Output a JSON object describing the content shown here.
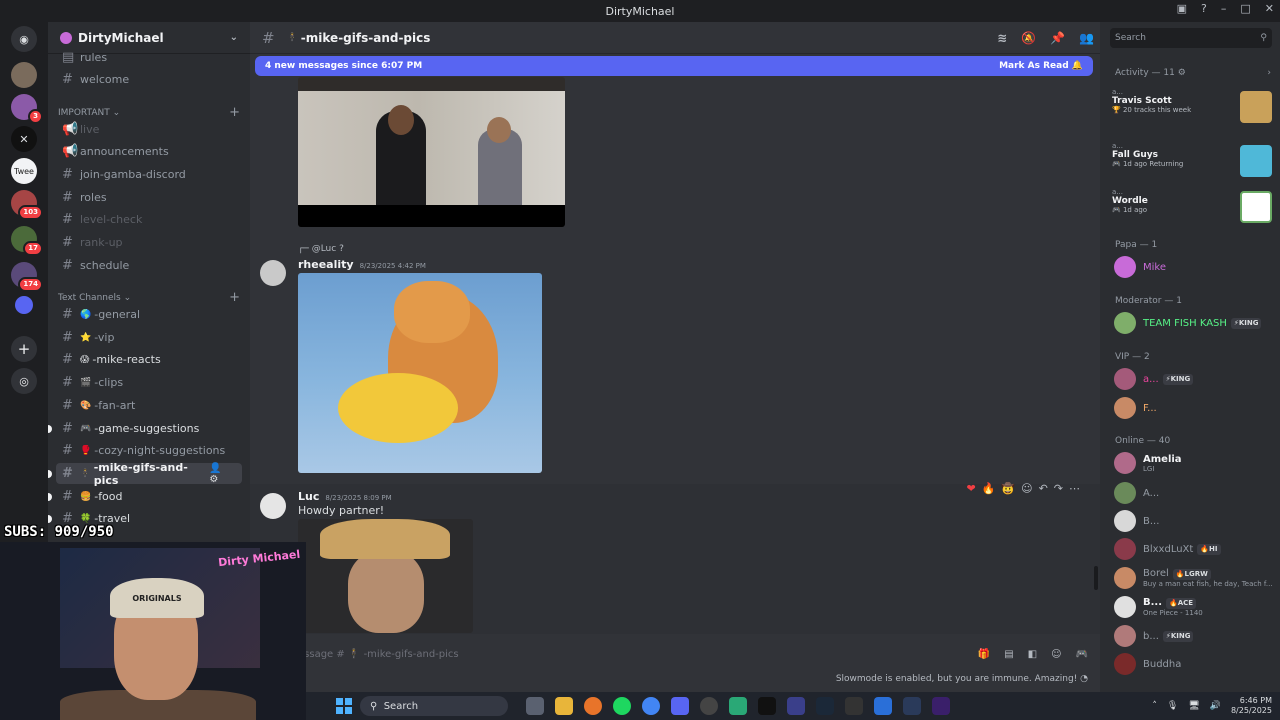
{
  "window": {
    "title": "DirtyMichael"
  },
  "guild": {
    "name": "DirtyMichael"
  },
  "channels": {
    "top": [
      "rules",
      "welcome"
    ],
    "important_label": "IMPORTANT",
    "important": [
      {
        "name": "live",
        "state": "dim"
      },
      {
        "name": "announcements",
        "state": "normal"
      },
      {
        "name": "join-gamba-discord",
        "state": "normal"
      },
      {
        "name": "roles",
        "state": "normal"
      },
      {
        "name": "level-check",
        "state": "dim"
      },
      {
        "name": "rank-up",
        "state": "dim"
      },
      {
        "name": "schedule",
        "state": "normal"
      }
    ],
    "text_label": "Text Channels",
    "text": [
      {
        "emoji": "🌎",
        "name": "-general",
        "state": "normal"
      },
      {
        "emoji": "⭐",
        "name": "-vip",
        "state": "normal"
      },
      {
        "emoji": "😱",
        "name": "-mike-reacts",
        "state": "bright"
      },
      {
        "emoji": "🎬",
        "name": "-clips",
        "state": "normal"
      },
      {
        "emoji": "🎨",
        "name": "-fan-art",
        "state": "normal"
      },
      {
        "emoji": "🎮",
        "name": "-game-suggestions",
        "state": "bright"
      },
      {
        "emoji": "🥊",
        "name": "-cozy-night-suggestions",
        "state": "normal"
      },
      {
        "emoji": "🕴",
        "name": "-mike-gifs-and-pics",
        "state": "active"
      },
      {
        "emoji": "🍔",
        "name": "-food",
        "state": "bright"
      },
      {
        "emoji": "🍀",
        "name": "-travel",
        "state": "bright"
      }
    ]
  },
  "servers": {
    "badges": [
      "3",
      "103",
      "17",
      "174"
    ]
  },
  "header": {
    "channel_name": "-mike-gifs-and-pics",
    "emoji": "🕴"
  },
  "new_messages": {
    "text": "4 new messages since 6:07 PM",
    "action": "Mark As Read"
  },
  "messages": [
    {
      "reply_to": "@Luc ?",
      "author": "rheeality",
      "timestamp": "8/23/2025 4:42 PM"
    },
    {
      "author": "Luc",
      "timestamp": "8/23/2025 8:09 PM",
      "text": "Howdy partner!"
    }
  ],
  "reactions": [
    "❤",
    "🔥",
    "🤠"
  ],
  "composer": {
    "placeholder": "essage # 🕴 -mike-gifs-and-pics"
  },
  "slowmode_text": "Slowmode is enabled, but you are immune. Amazing!",
  "search": {
    "placeholder": "Search"
  },
  "activity": {
    "label": "Activity — 11",
    "cards": [
      {
        "user": "a...",
        "name": "Travis Scott",
        "sub": "20 tracks this week",
        "color": "#c9a15a"
      },
      {
        "user": "a...",
        "name": "Fall Guys",
        "sub": "1d ago   Returning",
        "color": "#4fb8d8"
      },
      {
        "user": "a...",
        "name": "Wordle",
        "sub": "1d ago",
        "color": "#6aaa64"
      }
    ]
  },
  "member_sections": [
    {
      "label": "Papa — 1",
      "members": [
        {
          "name": "Mike",
          "color": "#c86bd8"
        }
      ]
    },
    {
      "label": "Moderator — 1",
      "members": [
        {
          "name": "TEAM FISH KASH",
          "color": "#57f287",
          "tag": "KING"
        }
      ]
    },
    {
      "label": "VIP — 2",
      "members": [
        {
          "name": "a...",
          "color": "#eb459e",
          "tag": "KING"
        },
        {
          "name": "F...",
          "color": "#f0a868"
        }
      ]
    },
    {
      "label": "Online — 40",
      "members": [
        {
          "name": "Amelia",
          "color": "#f2f3f5",
          "status": "LGI"
        },
        {
          "name": "A...",
          "color": "#949ba4"
        },
        {
          "name": "B...",
          "color": "#949ba4"
        },
        {
          "name": "BlxxdLuXt",
          "color": "#949ba4",
          "tag": "HI"
        },
        {
          "name": "Borel",
          "color": "#949ba4",
          "tag": "LGRW",
          "status": "Buy a man eat fish, he day, Teach f..."
        },
        {
          "name": "B...",
          "color": "#f2f3f5",
          "tag": "ACE",
          "status": "One Piece - 1140"
        },
        {
          "name": "b...",
          "color": "#949ba4",
          "tag": "KING"
        },
        {
          "name": "Buddha",
          "color": "#949ba4"
        }
      ]
    }
  ],
  "overlay": {
    "subs": "SUBS: 909/950",
    "cap_text": "ORIGINALS",
    "neon": "Dirty Michael"
  },
  "taskbar": {
    "search": "Search",
    "time": "6:46 PM",
    "date": "8/25/2025"
  }
}
